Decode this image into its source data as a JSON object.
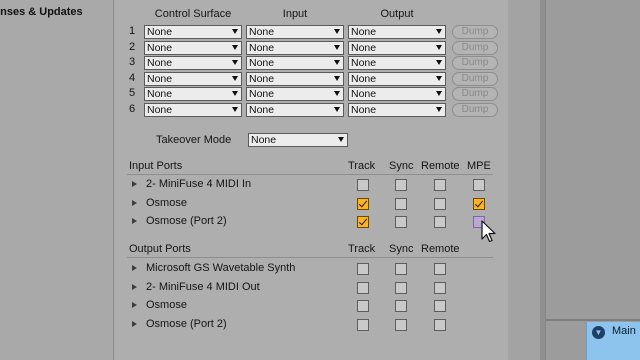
{
  "sidebar": {
    "item_partial": "enses & Updates"
  },
  "columns": {
    "control_surface": "Control Surface",
    "input": "Input",
    "output": "Output"
  },
  "surface_rows": [
    {
      "num": "1",
      "surface": "None",
      "input": "None",
      "output": "None",
      "dump": "Dump"
    },
    {
      "num": "2",
      "surface": "None",
      "input": "None",
      "output": "None",
      "dump": "Dump"
    },
    {
      "num": "3",
      "surface": "None",
      "input": "None",
      "output": "None",
      "dump": "Dump"
    },
    {
      "num": "4",
      "surface": "None",
      "input": "None",
      "output": "None",
      "dump": "Dump"
    },
    {
      "num": "5",
      "surface": "None",
      "input": "None",
      "output": "None",
      "dump": "Dump"
    },
    {
      "num": "6",
      "surface": "None",
      "input": "None",
      "output": "None",
      "dump": "Dump"
    }
  ],
  "takeover": {
    "label": "Takeover Mode",
    "value": "None"
  },
  "input_ports": {
    "title": "Input Ports",
    "headers": {
      "track": "Track",
      "sync": "Sync",
      "remote": "Remote",
      "mpe": "MPE"
    },
    "ports": [
      {
        "name": "2- MiniFuse 4 MIDI In",
        "track": false,
        "sync": false,
        "remote": false,
        "mpe": false
      },
      {
        "name": "Osmose",
        "track": true,
        "sync": false,
        "remote": false,
        "mpe": true
      },
      {
        "name": "Osmose (Port 2)",
        "track": true,
        "sync": false,
        "remote": false,
        "mpe": false
      }
    ]
  },
  "output_ports": {
    "title": "Output Ports",
    "headers": {
      "track": "Track",
      "sync": "Sync",
      "remote": "Remote"
    },
    "ports": [
      {
        "name": "Microsoft GS Wavetable Synth",
        "track": false,
        "sync": false,
        "remote": false
      },
      {
        "name": "2- MiniFuse 4 MIDI Out",
        "track": false,
        "sync": false,
        "remote": false
      },
      {
        "name": "Osmose",
        "track": false,
        "sync": false,
        "remote": false
      },
      {
        "name": "Osmose (Port 2)",
        "track": false,
        "sync": false,
        "remote": false
      }
    ]
  },
  "right_panel": {
    "main_label": "Main",
    "main_icon": "chevron-down-circle-icon"
  },
  "colors": {
    "accent_checked": "#ffb21f",
    "chip_blue": "#8cc4ee",
    "hover_purple": "#b9a9d2"
  }
}
